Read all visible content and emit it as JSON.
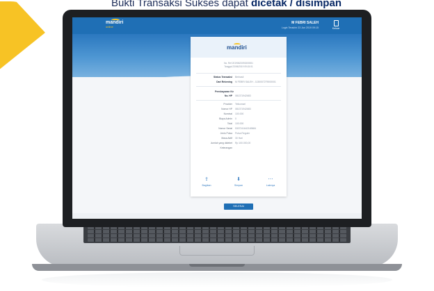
{
  "headline": {
    "prefix": "Bukti Transaksi Sukses dapat ",
    "emphasis": "dicetak / disimpan"
  },
  "app": {
    "logo_text": "mandiri",
    "logo_sub": "online",
    "user_name": "M FEBRI SALEH",
    "last_login": "Login Terakhir 23 Jun 2019 09:15",
    "logout_label": "Keluar"
  },
  "receipt": {
    "logo_text": "mandiri",
    "ref_line1": "No. Ref 20190623091500001",
    "ref_line2": "Tanggal 23/06/2019 09:15:01",
    "status_label": "Status Transaksi",
    "status_value": "Berhasil",
    "from_label": "Dari Rekening",
    "from_value": "M FEBRI SALEH - 1130007279000001",
    "section_payment": "Pembayaran Ke",
    "ref_no_label": "No. HP",
    "ref_no_value": "081371942683",
    "details": [
      {
        "k": "Provider",
        "v": "Telkomsel"
      },
      {
        "k": "Nomor HP",
        "v": "081371942683"
      },
      {
        "k": "Nominal",
        "v": "100.000"
      },
      {
        "k": "Biaya Admin",
        "v": "0"
      },
      {
        "k": "Total",
        "v": "100.000"
      },
      {
        "k": "Nomor Serial",
        "v": "5307241642169684"
      },
      {
        "k": "Jenis Pulsa",
        "v": "Pulsa Reguler"
      },
      {
        "k": "Masa Aktif",
        "v": "30 Hari"
      },
      {
        "k": "Jumlah yang didebet",
        "v": "Rp 100.000,00"
      },
      {
        "k": "Keterangan",
        "v": ""
      }
    ],
    "actions": [
      {
        "label": "Bagikan",
        "icon": "share-icon",
        "glyph": "⇪"
      },
      {
        "label": "Simpan",
        "icon": "download-icon",
        "glyph": "⬇"
      },
      {
        "label": "Lainnya",
        "icon": "more-icon",
        "glyph": "⋯"
      }
    ]
  },
  "done_label": "SELESAI"
}
